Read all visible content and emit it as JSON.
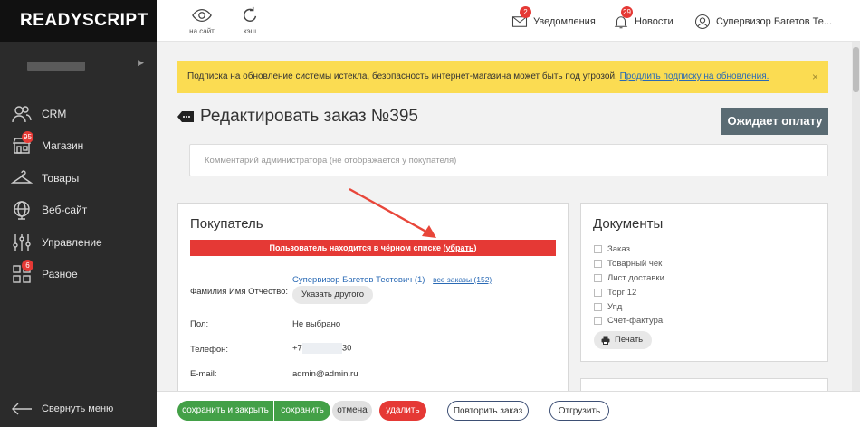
{
  "sidebar": {
    "logo": "READYSCRIPT",
    "items": [
      {
        "label": "CRM",
        "icon": "people-icon",
        "badge": ""
      },
      {
        "label": "Магазин",
        "icon": "shop-icon",
        "badge": "95"
      },
      {
        "label": "Товары",
        "icon": "hanger-icon",
        "badge": ""
      },
      {
        "label": "Веб-сайт",
        "icon": "globe-icon",
        "badge": ""
      },
      {
        "label": "Управление",
        "icon": "sliders-icon",
        "badge": ""
      },
      {
        "label": "Разное",
        "icon": "grid-icon",
        "badge": "6"
      }
    ],
    "collapse_label": "Свернуть меню"
  },
  "topbar": {
    "to_site": "на сайт",
    "cache": "кэш",
    "notifications_label": "Уведомления",
    "notifications_count": "2",
    "news_label": "Новости",
    "news_count": "29",
    "user_name": "Супервизор Багетов Те..."
  },
  "alert": {
    "text": "Подписка на обновление системы истекла, безопасность интернет-магазина может быть под угрозой.",
    "link": "Продлить подписку на обновления.",
    "close": "×"
  },
  "page": {
    "title": "Редактировать заказ №395",
    "status": "Ожидает оплату",
    "comment_placeholder": "Комментарий администратора (не отображается у покупателя)"
  },
  "buyer": {
    "title": "Покупатель",
    "blacklist_text": "Пользователь находится в чёрном списке (",
    "blacklist_link": "убрать",
    "blacklist_end": ")",
    "fio_label": "Фамилия Имя Отчество:",
    "fio_value": "Супервизор Багетов Тестович (1)",
    "all_orders": "все заказы (152)",
    "change_button": "Указать другого",
    "sex_label": "Пол:",
    "sex_value": "Не выбрано",
    "phone_label": "Телефон:",
    "phone_start": "+7",
    "phone_end": "30",
    "email_label": "E-mail:",
    "email_value": "admin@admin.ru"
  },
  "documents": {
    "title": "Документы",
    "items": [
      "Заказ",
      "Товарный чек",
      "Лист доставки",
      "Торг 12",
      "Упд",
      "Счет-фактура"
    ],
    "print_button": "Печать"
  },
  "bottombar": {
    "save_close": "сохранить и закрыть",
    "save": "сохранить",
    "cancel": "отмена",
    "delete": "удалить",
    "repeat": "Повторить заказ",
    "unload": "Отгрузить"
  },
  "colors": {
    "accent_red": "#e53935",
    "alert_yellow": "#fbdc52",
    "save_green": "#43a047",
    "status_gray": "#5a6b73"
  }
}
